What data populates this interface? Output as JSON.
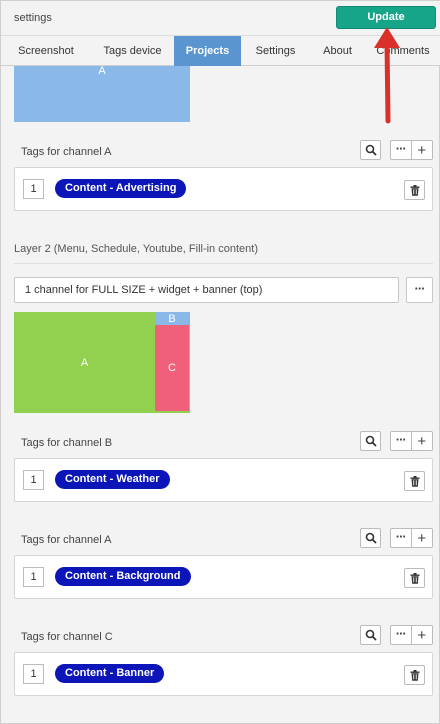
{
  "window": {
    "title": "settings",
    "update_label": "Update"
  },
  "tabs": [
    {
      "label": "Screenshot"
    },
    {
      "label": "Tags device"
    },
    {
      "label": "Projects",
      "active": true
    },
    {
      "label": "Settings"
    },
    {
      "label": "About"
    },
    {
      "label": "Comments"
    }
  ],
  "layer1": {
    "zone_label": "A",
    "tag_group": {
      "header": "Tags for channel A",
      "row": {
        "number": "1",
        "tag": "Content - Advertising"
      }
    }
  },
  "layer2": {
    "title": "Layer 2 (Menu, Schedule, Youtube, Fill-in content)",
    "layout_select": "1 channel for FULL SIZE + widget + banner (top)",
    "zones": [
      {
        "label": "A",
        "color": "#92d050"
      },
      {
        "label": "B",
        "color": "#8ab8e8"
      },
      {
        "label": "C",
        "color": "#f0607a"
      }
    ],
    "tag_groups": [
      {
        "header": "Tags for channel B",
        "row": {
          "number": "1",
          "tag": "Content - Weather"
        }
      },
      {
        "header": "Tags for channel A",
        "row": {
          "number": "1",
          "tag": "Content - Background"
        }
      },
      {
        "header": "Tags for channel C",
        "row": {
          "number": "1",
          "tag": "Content - Banner"
        }
      }
    ]
  },
  "icons": {
    "search": "search-icon",
    "more": "more-dots-icon",
    "add": "plus-icon",
    "delete": "trash-icon"
  },
  "colors": {
    "accent_tab": "#5a95cf",
    "update_button": "#17a589",
    "tag_pill": "#0b15b8",
    "annotation_arrow": "#d9302a",
    "zone_layer1": "#8ab8e8"
  }
}
